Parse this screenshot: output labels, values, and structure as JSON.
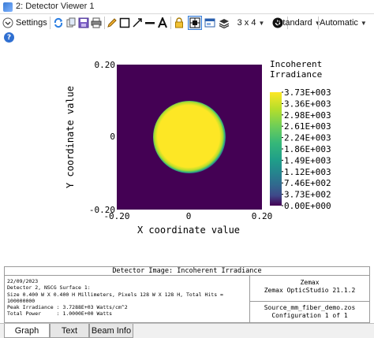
{
  "window": {
    "title": "2: Detector Viewer 1"
  },
  "toolbar": {
    "settings_label": "Settings",
    "layout_label": "3 x 4",
    "style_label": "Standard",
    "scale_label": "Automatic"
  },
  "colors": {
    "viridis_dark": "#440154",
    "viridis_yellow": "#fde725",
    "tab_active": "#ffffff",
    "tab_inactive": "#e6e6e6"
  },
  "chart_data": {
    "type": "heatmap",
    "xlabel": "X coordinate value",
    "ylabel": "Y coordinate value",
    "x_ticks": [
      "-0.20",
      "0",
      "0.20"
    ],
    "y_ticks": [
      "0.20",
      "0",
      "-0.20"
    ],
    "xlim": [
      -0.2,
      0.2
    ],
    "ylim": [
      -0.2,
      0.2
    ],
    "colorbar_title": [
      "Incoherent",
      "Irradiance"
    ],
    "colorbar_labels": [
      "3.73E+003",
      "3.36E+003",
      "2.98E+003",
      "2.61E+003",
      "2.24E+003",
      "1.86E+003",
      "1.49E+003",
      "1.12E+003",
      "7.46E+002",
      "3.73E+002",
      "0.00E+000"
    ],
    "colorbar_min": 0,
    "colorbar_max": 3730,
    "spot": {
      "center_x": 0,
      "center_y": 0,
      "radius": 0.1,
      "peak": 3728.8
    }
  },
  "info": {
    "title": "Detector Image: Incoherent Irradiance",
    "lines": [
      "22/09/2023",
      "Detector 2, NSCG Surface 1:",
      "Size 0.400 W X 0.400 H Millimeters, Pixels 128 W X 128 H, Total Hits = 100000000",
      "Peak Irradiance : 3.7288E+03 Watts/cm^2",
      "Total Power     : 1.0000E+00 Watts"
    ],
    "company": "Zemax",
    "product": "Zemax OpticStudio 21.1.2",
    "file": "Source_mm_fiber_demo.zos",
    "config": "Configuration 1 of 1"
  },
  "tabs": [
    {
      "label": "Graph",
      "active": true
    },
    {
      "label": "Text",
      "active": false
    },
    {
      "label": "Beam Info",
      "active": false
    }
  ]
}
